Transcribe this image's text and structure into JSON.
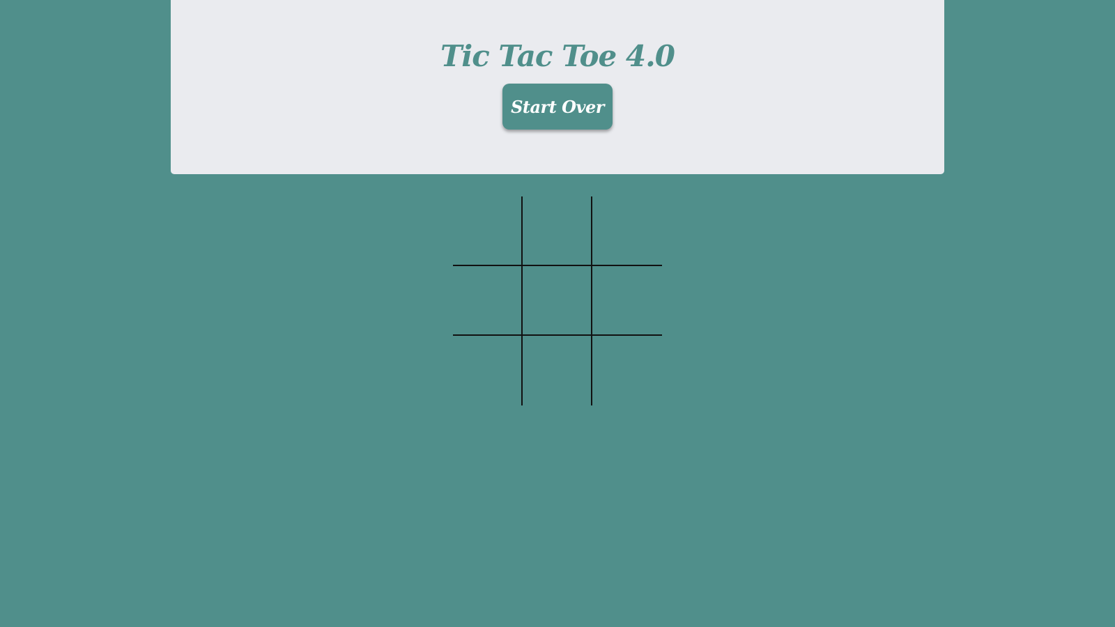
{
  "header": {
    "title": "Tic Tac Toe 4.0",
    "start_over_label": "Start Over"
  },
  "board": {
    "cells": [
      "",
      "",
      "",
      "",
      "",
      "",
      "",
      "",
      ""
    ]
  },
  "colors": {
    "background": "#508f8b",
    "card": "#eaebef",
    "accent": "#508f8b",
    "grid_lines": "#111111"
  }
}
